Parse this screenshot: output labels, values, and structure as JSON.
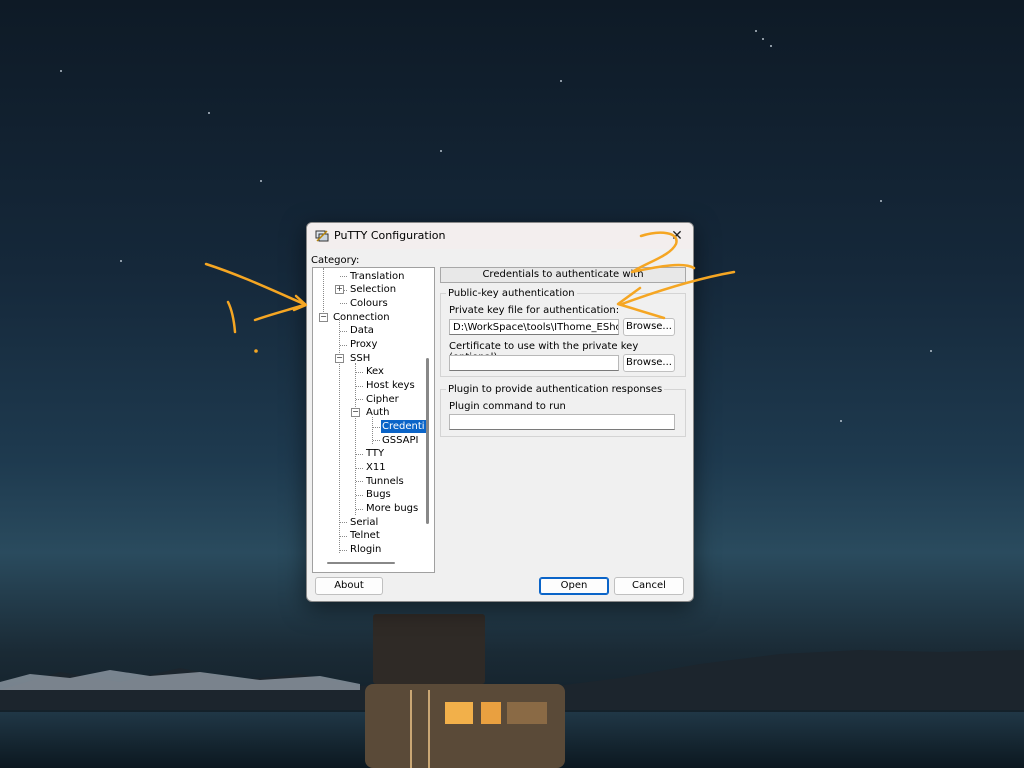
{
  "window": {
    "title": "PuTTY Configuration",
    "close_glyph": "✕",
    "icon": "putty-app-icon"
  },
  "category": {
    "label": "Category:",
    "tree": [
      {
        "label": "Translation"
      },
      {
        "label": "Selection",
        "expander": "+"
      },
      {
        "label": "Colours"
      },
      {
        "label": "Connection",
        "expander": "−"
      },
      {
        "label": "Data"
      },
      {
        "label": "Proxy"
      },
      {
        "label": "SSH",
        "expander": "−"
      },
      {
        "label": "Kex"
      },
      {
        "label": "Host keys"
      },
      {
        "label": "Cipher"
      },
      {
        "label": "Auth",
        "expander": "−"
      },
      {
        "label": "Credenti",
        "selected": true
      },
      {
        "label": "GSSAPI"
      },
      {
        "label": "TTY"
      },
      {
        "label": "X11"
      },
      {
        "label": "Tunnels"
      },
      {
        "label": "Bugs"
      },
      {
        "label": "More bugs"
      },
      {
        "label": "Serial"
      },
      {
        "label": "Telnet"
      },
      {
        "label": "Rlogin"
      }
    ]
  },
  "panel": {
    "header": "Credentials to authenticate with",
    "pubkey_group": {
      "title": "Public-key authentication",
      "private_key_label": "Private key file for authentication:",
      "private_key_value": "D:\\WorkSpace\\tools\\IThome_EShoppin",
      "browse_label": "Browse...",
      "certificate_label": "Certificate to use with the private key (optional):",
      "certificate_value": "",
      "browse2_label": "Browse..."
    },
    "plugin_group": {
      "title": "Plugin to provide authentication responses",
      "command_label": "Plugin command to run",
      "command_value": ""
    }
  },
  "buttons": {
    "about": "About",
    "open": "Open",
    "cancel": "Cancel"
  },
  "annotations": {
    "color": "#f5a623",
    "mark_1": "1",
    "mark_2": "2"
  }
}
